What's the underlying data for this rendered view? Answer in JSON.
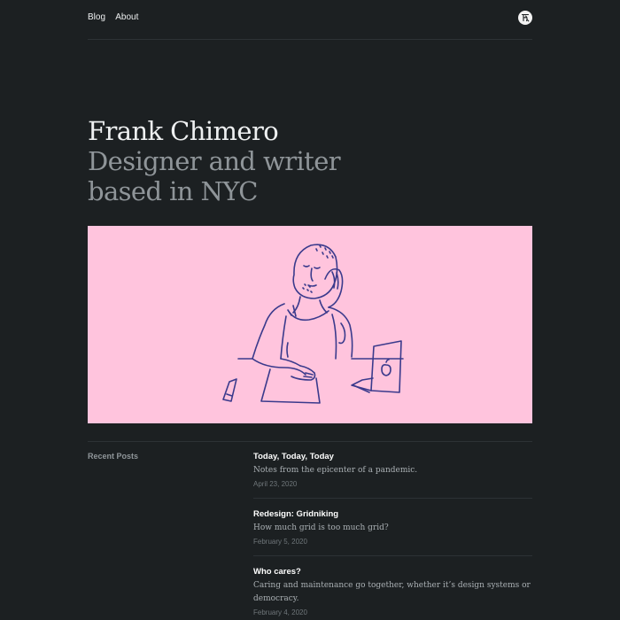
{
  "nav": {
    "links": [
      "Blog",
      "About"
    ]
  },
  "logo": {
    "icon": "fc-monogram-icon"
  },
  "hero": {
    "name": "Frank Chimero",
    "tagline": "Designer and writer based in NYC"
  },
  "illustration": {
    "icon": "man-at-laptop-illustration",
    "background": "#ffc4dd",
    "stroke": "#3a3a8c"
  },
  "recent": {
    "label": "Recent Posts",
    "posts": [
      {
        "title": "Today, Today, Today",
        "description": "Notes from the epicenter of a pandemic.",
        "date": "April 23, 2020"
      },
      {
        "title": "Redesign: Gridniking",
        "description": "How much grid is too much grid?",
        "date": "February 5, 2020"
      },
      {
        "title": "Who cares?",
        "description": "Caring and maintenance go together, whether it’s design systems or democracy.",
        "date": "February 4, 2020"
      }
    ]
  },
  "colors": {
    "background": "#1c2022",
    "text": "#eef0f1",
    "muted": "#8f9599",
    "divider": "#2d3235"
  }
}
